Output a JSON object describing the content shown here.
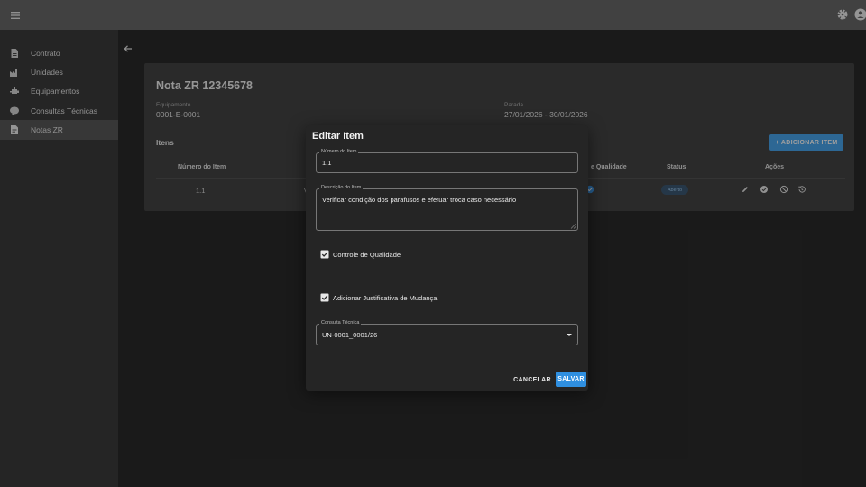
{
  "colors": {
    "appbar": "#6a6a6a",
    "sidebar": "#3c3c3c",
    "accent": "#2f8fe0",
    "badge_text": "#9ccaf2"
  },
  "sidebar": {
    "items": [
      {
        "label": "Contrato",
        "icon": "document-icon"
      },
      {
        "label": "Unidades",
        "icon": "factory-icon"
      },
      {
        "label": "Equipamentos",
        "icon": "equipment-icon"
      },
      {
        "label": "Consultas Técnicas",
        "icon": "chat-icon"
      },
      {
        "label": "Notas ZR",
        "icon": "note-icon",
        "active": true
      }
    ]
  },
  "note": {
    "title": "Nota ZR 12345678",
    "equipamento_label": "Equipamento",
    "equipamento_value": "0001-E-0001",
    "parada_label": "Parada",
    "parada_value": "27/01/2026 - 30/01/2026",
    "itens_label": "Itens",
    "add_button": "+ ADICIONAR ITEM"
  },
  "table": {
    "headers": [
      "Número do Item",
      "e Qualidade",
      "Status",
      "Ações"
    ],
    "row": {
      "numero": "1.1",
      "desc_fragment": "V",
      "status": "Aberto"
    }
  },
  "dialog": {
    "title": "Editar Item",
    "numero_label": "Número do Item",
    "numero_value": "1.1",
    "descricao_label": "Descrição do Item",
    "descricao_value": "Verificar condição dos parafusos e efetuar troca caso necessário",
    "qualidade_label": "Controle de Qualidade",
    "qualidade_checked": true,
    "justificativa_label": "Adicionar Justificativa de Mudança",
    "justificativa_checked": true,
    "consulta_label": "Consulta Técnica",
    "consulta_value": "UN-0001_0001/26",
    "cancel": "CANCELAR",
    "save": "SALVAR"
  }
}
